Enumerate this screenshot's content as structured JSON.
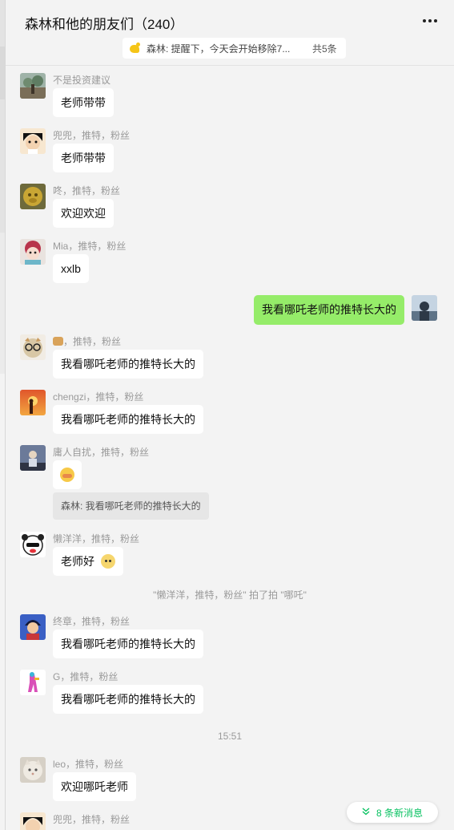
{
  "header": {
    "title": "森林和他的朋友们（240）",
    "pinned_text": "森林: 提醒下，今天会开始移除7...",
    "pinned_count": "共5条"
  },
  "messages": [
    {
      "sender": "不是投资建议",
      "text": "老师带带"
    },
    {
      "sender": "兜兜，推特，粉丝",
      "text": "老师带带"
    },
    {
      "sender": "咚，推特，粉丝",
      "text": "欢迎欢迎"
    },
    {
      "sender": "Mia，推特，粉丝",
      "text": "xxlb"
    },
    {
      "sender": "",
      "text": "我看哪吒老师的推特长大的"
    },
    {
      "sender": "，推特，粉丝",
      "text": "我看哪吒老师的推特长大的"
    },
    {
      "sender": "chengzi，推特，粉丝",
      "text": "我看哪吒老师的推特长大的"
    },
    {
      "sender": "庸人自扰，推特，粉丝",
      "text": "",
      "quote": "森林: 我看哪吒老师的推特长大的"
    },
    {
      "sender": "懒洋洋，推特，粉丝",
      "text": "老师好"
    },
    {
      "sender": "终章，推特，粉丝",
      "text": "我看哪吒老师的推特长大的"
    },
    {
      "sender": "G，推特，粉丝",
      "text": "我看哪吒老师的推特长大的"
    },
    {
      "sender": "leo，推特，粉丝",
      "text": "欢迎哪吒老师"
    },
    {
      "sender": "兜兜，推特，粉丝",
      "text": ""
    }
  ],
  "system": {
    "pat_notice": "\"懒洋洋，推特，粉丝\" 拍了拍 \"哪吒\"",
    "time": "15:51"
  },
  "new_messages": {
    "label": "8 条新消息"
  },
  "colors": {
    "accent_green": "#07c160",
    "self_bubble": "#95ec69"
  }
}
